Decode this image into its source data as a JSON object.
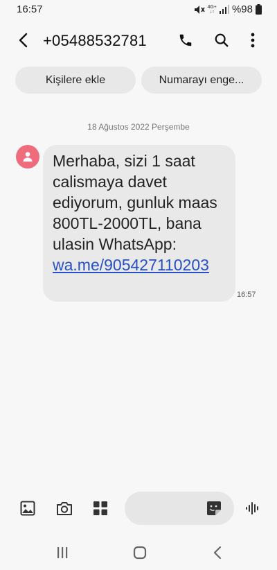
{
  "status_bar": {
    "time": "16:57",
    "network_top": "4G+",
    "network_bottom": "↓↑",
    "battery": "%98"
  },
  "header": {
    "title": "+05488532781"
  },
  "chips": {
    "add_contact": "Kişilere ekle",
    "block_number": "Numarayı enge..."
  },
  "conversation": {
    "date_label": "18 Ağustos 2022 Perşembe",
    "message": {
      "text": "Merhaba, sizi 1 saat calismaya davet ediyorum, gunluk maas 800TL-2000TL, bana ulasin WhatsApp: ",
      "link": "wa.me/905427110203",
      "time": "16:57"
    }
  },
  "colors": {
    "avatar": "#ee6c7c",
    "link": "#2750c4",
    "bubble": "#e9e9e9",
    "background": "#f7f7f7"
  },
  "icons": [
    "back-arrow-icon",
    "phone-icon",
    "search-icon",
    "more-vert-icon",
    "gallery-icon",
    "camera-icon",
    "apps-icon",
    "sticker-icon",
    "voice-icon",
    "recents-icon",
    "home-icon",
    "nav-back-icon"
  ]
}
